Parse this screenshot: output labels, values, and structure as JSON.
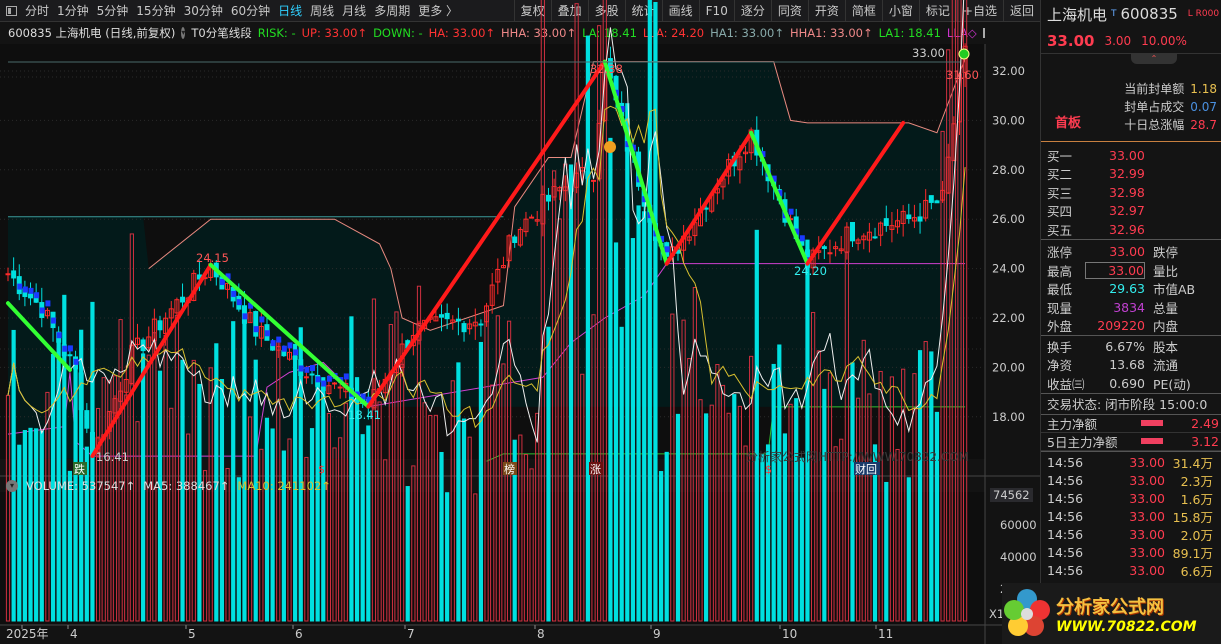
{
  "toolbar": {
    "periods": [
      "分时",
      "1分钟",
      "5分钟",
      "15分钟",
      "30分钟",
      "60分钟",
      "日线",
      "周线",
      "月线",
      "多周期",
      "更多 〉"
    ],
    "active": "日线",
    "actions": [
      "复权",
      "叠加",
      "多股",
      "统计",
      "画线",
      "F10",
      "逐分",
      "同资",
      "开资",
      "简框",
      "小窗",
      "标记",
      "+自选",
      "返回"
    ]
  },
  "info": {
    "title": "600835 上海机电 (日线,前复权)",
    "indicator": "T0分笔线段",
    "risk": "RISK: -",
    "up": "UP: 33.00↑",
    "down": "DOWN: -",
    "ha": "HA: 33.00↑",
    "hha": "HHA: 33.00↑",
    "la": "LA: 18.41",
    "lla": "LLA: 24.20",
    "ha1": "HA1: 33.00↑",
    "hha1": "HHA1: 33.00↑",
    "la1": "LA1: 18.41",
    "lla_": "LLA◇"
  },
  "volume_info": {
    "volume": "VOLUME: 537547↑",
    "ma5": "MA5: 388467↑",
    "ma10": "MA10: 241102↑"
  },
  "price_axis": [
    "32.00",
    "30.00",
    "28.00",
    "26.00",
    "24.00",
    "22.00",
    "20.00",
    "18.00"
  ],
  "volume_axis": {
    "top": "74562",
    "ticks": [
      "60000",
      "40000",
      "20000"
    ],
    "unit": "X10"
  },
  "months": [
    "2025年",
    "4",
    "5",
    "6",
    "7",
    "8",
    "9",
    "10",
    "11"
  ],
  "date_axis_right": "日",
  "annotations": {
    "high1": "24.15",
    "low1": "16.41",
    "low2": "18.41",
    "high2": "32.38",
    "low3": "24.20",
    "last": "33.00",
    "last2": "31.60"
  },
  "markers": [
    "跌",
    "$",
    "榜",
    "涨",
    "$",
    "财回"
  ],
  "watermark": "分析家公式网HTTP://WWW.70822.COM",
  "quote": {
    "name": "上海机电",
    "code": "600835",
    "flags": "L R000",
    "price": "33.00",
    "change": "3.00",
    "pct": "10.00%",
    "tag": "首板",
    "stats": [
      {
        "label": "当前封单额",
        "value": "1.18"
      },
      {
        "label": "封单占成交",
        "value": "0.07"
      },
      {
        "label": "十日总涨幅",
        "value": "28.7"
      }
    ],
    "bids": [
      {
        "label": "买一",
        "value": "33.00"
      },
      {
        "label": "买二",
        "value": "32.99"
      },
      {
        "label": "买三",
        "value": "32.98"
      },
      {
        "label": "买四",
        "value": "32.97"
      },
      {
        "label": "买五",
        "value": "32.96"
      }
    ],
    "grid1": [
      [
        "涨停",
        "33.00",
        "跌停"
      ],
      [
        "最高",
        "33.00",
        "量比"
      ],
      [
        "最低",
        "29.63",
        "市值AB"
      ],
      [
        "现量",
        "3834",
        "总量"
      ],
      [
        "外盘",
        "209220",
        "内盘"
      ]
    ],
    "grid2": [
      [
        "换手",
        "6.67%",
        "股本"
      ],
      [
        "净资",
        "13.68",
        "流通"
      ],
      [
        "收益㈢",
        "0.690",
        "PE(动)"
      ]
    ],
    "status": "交易状态: 闭市阶段 15:00:0",
    "flow": [
      {
        "label": "主力净额",
        "value": "2.49"
      },
      {
        "label": "5日主力净额",
        "value": "3.12"
      }
    ],
    "ticks": [
      [
        "14:56",
        "33.00",
        "31.4万"
      ],
      [
        "14:56",
        "33.00",
        "2.3万"
      ],
      [
        "14:56",
        "33.00",
        "1.6万"
      ],
      [
        "14:56",
        "33.00",
        "15.8万"
      ],
      [
        "14:56",
        "33.00",
        "2.0万"
      ],
      [
        "14:56",
        "33.00",
        "89.1万"
      ],
      [
        "14:56",
        "33.00",
        "6.6万"
      ]
    ]
  },
  "logo": {
    "text": "分析家公式网",
    "url": "WWW.70822.COM"
  },
  "colors": {
    "up": "#ff2a2a",
    "down": "#00e0e0",
    "zigUp": "#ff1a1a",
    "zigDown": "#33ff33",
    "blue": "#1a3aff",
    "band": "#e88a80",
    "fill": "#031a1a",
    "magenta": "#d040d0"
  },
  "chart_data": {
    "type": "candlestick",
    "days": 171,
    "keypoints": [
      [
        0,
        23.8
      ],
      [
        6,
        22.4
      ],
      [
        12,
        19.8
      ],
      [
        15,
        16.41
      ],
      [
        22,
        20.5
      ],
      [
        36,
        24.15
      ],
      [
        44,
        21.5
      ],
      [
        52,
        20.0
      ],
      [
        64,
        18.41
      ],
      [
        72,
        21.5
      ],
      [
        84,
        22.0
      ],
      [
        90,
        25.5
      ],
      [
        98,
        27.2
      ],
      [
        104,
        28.0
      ],
      [
        106,
        32.38
      ],
      [
        110,
        29.0
      ],
      [
        117,
        24.2
      ],
      [
        124,
        26.8
      ],
      [
        132,
        29.5
      ],
      [
        142,
        24.2
      ],
      [
        150,
        25.5
      ],
      [
        160,
        26.0
      ],
      [
        166,
        26.8
      ],
      [
        170,
        33.0
      ]
    ],
    "zigzag": [
      [
        0,
        22.6,
        "d"
      ],
      [
        11,
        19.9,
        "x"
      ],
      [
        15,
        16.41,
        "u"
      ],
      [
        36,
        24.15,
        "d"
      ],
      [
        64,
        18.41,
        "u"
      ],
      [
        106,
        32.38,
        "d"
      ],
      [
        117,
        24.2,
        "u"
      ],
      [
        132,
        29.5,
        "d"
      ],
      [
        142,
        24.2,
        "u"
      ],
      [
        159,
        29.9,
        "x"
      ]
    ],
    "upper_band": [
      [
        25,
        24.0
      ],
      [
        36,
        26.0
      ],
      [
        58,
        26.0
      ],
      [
        66,
        25.0
      ],
      [
        68,
        24.0
      ],
      [
        70,
        22.0
      ],
      [
        75,
        21.5
      ],
      [
        88,
        22.5
      ],
      [
        90,
        26.5
      ],
      [
        96,
        28.5
      ],
      [
        100,
        28.5
      ],
      [
        104,
        32.38
      ],
      [
        136,
        32.38
      ],
      [
        139,
        30.0
      ],
      [
        142,
        29.9
      ],
      [
        160,
        29.9
      ],
      [
        165,
        29.5
      ],
      [
        170,
        32.5
      ]
    ],
    "cyan_line": [
      [
        0,
        26.1
      ],
      [
        88,
        26.1
      ]
    ],
    "lower_band": [
      [
        0,
        17.3
      ],
      [
        10,
        17.6
      ],
      [
        11,
        19.8
      ],
      [
        12,
        17.0
      ],
      [
        15,
        16.41
      ],
      [
        44,
        16.41
      ],
      [
        46,
        19.2
      ],
      [
        50,
        19.8
      ],
      [
        56,
        20.2
      ],
      [
        64,
        18.41
      ],
      [
        95,
        19.6
      ],
      [
        100,
        21.0
      ],
      [
        106,
        22.0
      ],
      [
        113,
        22.9
      ],
      [
        117,
        24.2
      ],
      [
        170,
        24.2
      ]
    ],
    "green_base": [
      [
        85,
        16.2
      ],
      [
        88,
        16.5
      ],
      [
        135,
        16.5
      ],
      [
        136,
        18.4
      ],
      [
        170,
        18.4
      ]
    ],
    "price_ylim": [
      16,
      33.5
    ],
    "volume_ylim": [
      0,
      74562
    ],
    "last_volume": 537547,
    "ma5": 388467,
    "ma10": 241102
  }
}
